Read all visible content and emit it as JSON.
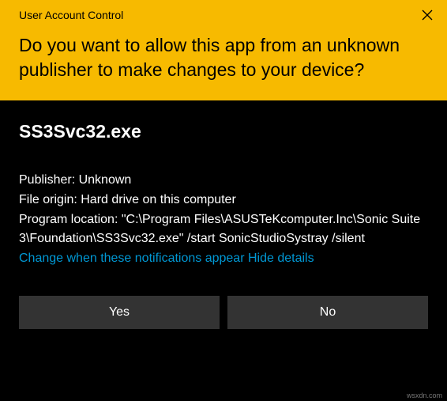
{
  "header": {
    "window_title": "User Account Control",
    "heading": "Do you want to allow this app from an unknown publisher to make changes to your device?"
  },
  "body": {
    "program_name": "SS3Svc32.exe",
    "publisher_label": "Publisher: ",
    "publisher_value": "Unknown",
    "origin_label": "File origin: ",
    "origin_value": "Hard drive on this computer",
    "location_label": "Program location: ",
    "location_value": "\"C:\\Program Files\\ASUSTeKcomputer.Inc\\Sonic Suite 3\\Foundation\\SS3Svc32.exe\" /start SonicStudioSystray /silent",
    "change_link": "Change when these notifications appear",
    "hide_link": "Hide details"
  },
  "buttons": {
    "yes": "Yes",
    "no": "No"
  },
  "watermark": "wsxdn.com"
}
